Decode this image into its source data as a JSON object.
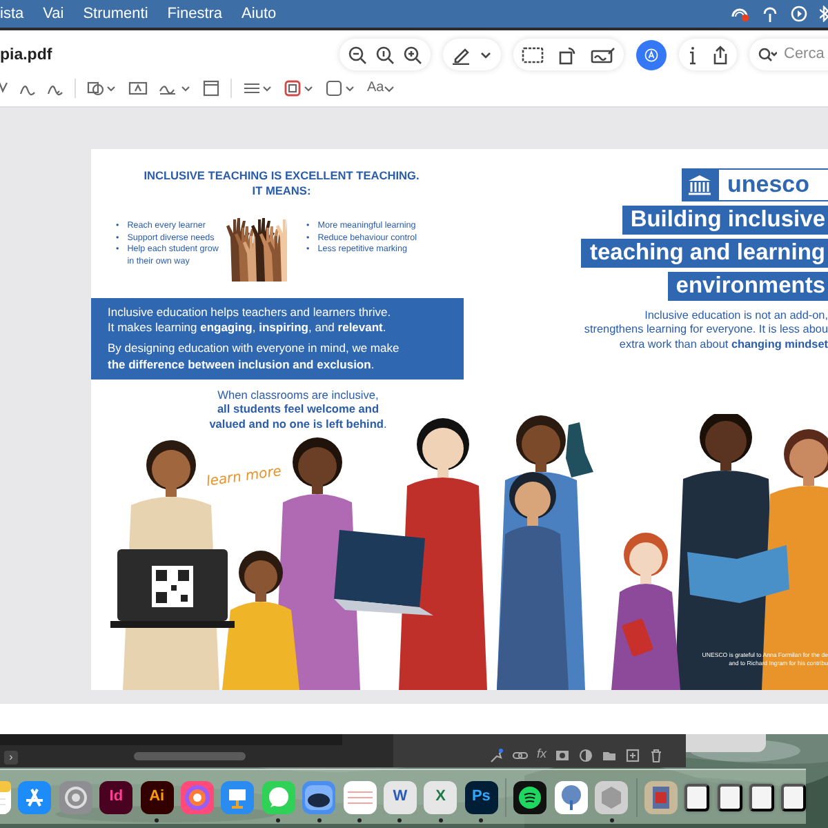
{
  "menubar": {
    "items": [
      {
        "label": "ista"
      },
      {
        "label": "Vai"
      },
      {
        "label": "Strumenti"
      },
      {
        "label": "Finestra"
      },
      {
        "label": "Aiuto"
      }
    ]
  },
  "window": {
    "title": "pia.pdf",
    "markup_on": true,
    "search": {
      "placeholder": "Cerca"
    },
    "font_button": "Aa"
  },
  "document": {
    "heading": [
      "INCLUSIVE TEACHING IS EXCELLENT TEACHING.",
      "IT MEANS:"
    ],
    "bullet_marker": "•",
    "bullets_left": [
      "Reach every learner",
      "Support diverse needs",
      "Help each student grow in their own way"
    ],
    "bullets_right": [
      "More meaningful learning",
      "Reduce behaviour control",
      "Less repetitive marking"
    ],
    "highlight_paragraphs": [
      [
        "Inclusive education helps teachers and learners thrive.",
        "It makes learning **engaging**, **inspiring**, and **relevant**."
      ],
      [
        "By designing education with everyone in mind, we make",
        "**the difference between inclusion and exclusion**."
      ]
    ],
    "closing": [
      "When classrooms are inclusive,",
      "**all students feel welcome and**",
      "**valued and no one is left behind**."
    ],
    "logo_text": "unesco",
    "title_lines": [
      "Building inclusive",
      "teaching and learning",
      "environments"
    ],
    "subtitle": [
      "Inclusive education is not an add-on,",
      "strengthens learning for everyone. It is less abou",
      "extra work than about **changing mindset**"
    ],
    "learn_more": "learn more",
    "credits": [
      "UNESCO is grateful to Anna Formilan for the de",
      "and to Richard Ingram for his contribu"
    ]
  },
  "lower_panel": {
    "chevron": "›",
    "fx": "fx"
  },
  "dock": {
    "apps": [
      {
        "kind": "notes",
        "running": false
      },
      {
        "kind": "appstore",
        "running": false
      },
      {
        "kind": "settings",
        "running": false
      },
      {
        "kind": "indesign",
        "glyph": "Id",
        "running": false
      },
      {
        "kind": "illustrator",
        "glyph": "Ai",
        "running": true
      },
      {
        "kind": "cloud",
        "running": false
      },
      {
        "kind": "keynote",
        "running": false
      },
      {
        "kind": "chat",
        "running": true
      },
      {
        "kind": "disk",
        "running": true
      },
      {
        "kind": "notepad",
        "running": true
      },
      {
        "kind": "word",
        "glyph": "W",
        "running": true
      },
      {
        "kind": "excel",
        "glyph": "X",
        "running": true
      },
      {
        "kind": "photoshop",
        "glyph": "Ps",
        "running": true
      },
      {
        "kind": "divider"
      },
      {
        "kind": "music",
        "running": false
      },
      {
        "kind": "tree",
        "running": false
      },
      {
        "kind": "gray",
        "running": true
      },
      {
        "kind": "divider"
      },
      {
        "kind": "thumbnail"
      },
      {
        "kind": "window"
      },
      {
        "kind": "window"
      },
      {
        "kind": "window"
      },
      {
        "kind": "window"
      }
    ]
  }
}
